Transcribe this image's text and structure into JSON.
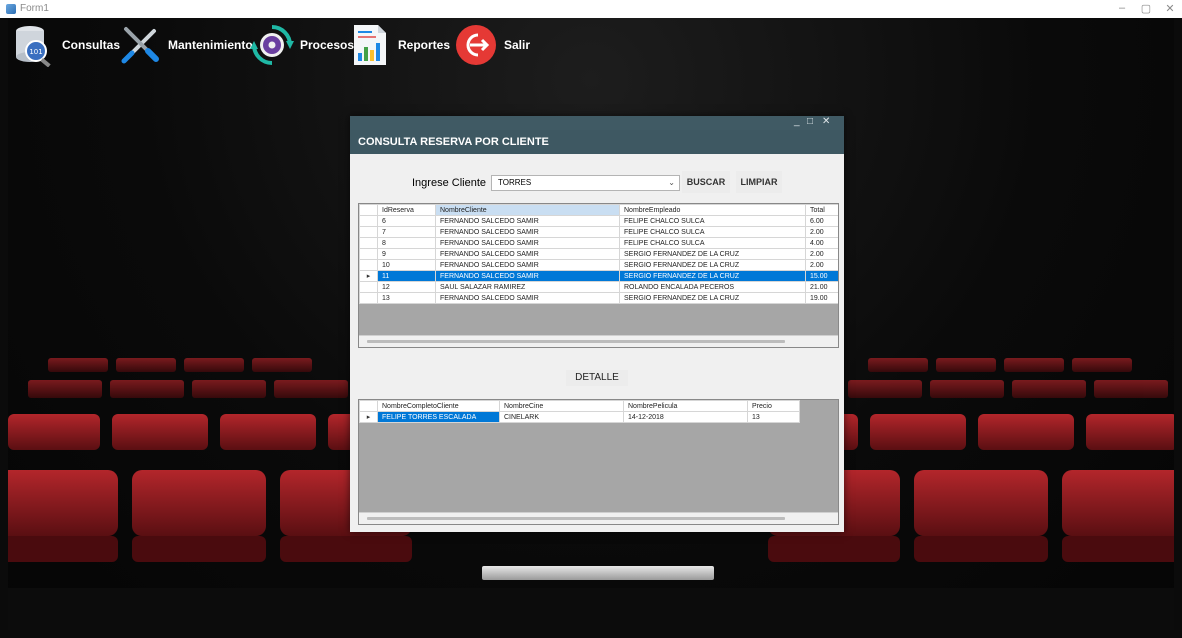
{
  "window": {
    "title": "Form1",
    "controls": [
      "–",
      "▢",
      "✕"
    ]
  },
  "menu": [
    {
      "label": "Consultas",
      "icon": "database-search-icon"
    },
    {
      "label": "Mantenimiento",
      "icon": "tools-icon"
    },
    {
      "label": "Procesos",
      "icon": "process-gear-icon"
    },
    {
      "label": "Reportes",
      "icon": "report-chart-icon"
    },
    {
      "label": "Salir",
      "icon": "exit-icon"
    }
  ],
  "form": {
    "caption": "CONSULTA RESERVA POR CLIENTE",
    "controls": [
      "_",
      "□",
      "✕"
    ],
    "cliente_label": "Ingrese Cliente",
    "cliente_value": "TORRES",
    "buscar_label": "BUSCAR",
    "limpiar_label": "LIMPIAR",
    "detalle_label": "DETALLE"
  },
  "reservas": {
    "columns": [
      "IdReserva",
      "NombreCliente",
      "NombreEmpleado",
      "Total"
    ],
    "selected_index": 5,
    "rows": [
      [
        "6",
        "FERNANDO SALCEDO SAMIR",
        "FELIPE CHALCO SULCA",
        "6.00"
      ],
      [
        "7",
        "FERNANDO SALCEDO SAMIR",
        "FELIPE CHALCO SULCA",
        "2.00"
      ],
      [
        "8",
        "FERNANDO SALCEDO SAMIR",
        "FELIPE CHALCO SULCA",
        "4.00"
      ],
      [
        "9",
        "FERNANDO SALCEDO SAMIR",
        "SERGIO FERNANDEZ DE LA CRUZ",
        "2.00"
      ],
      [
        "10",
        "FERNANDO SALCEDO SAMIR",
        "SERGIO FERNANDEZ DE LA CRUZ",
        "2.00"
      ],
      [
        "11",
        "FERNANDO SALCEDO SAMIR",
        "SERGIO FERNANDEZ DE LA CRUZ",
        "15.00"
      ],
      [
        "12",
        "SAUL SALAZAR RAMIREZ",
        "ROLANDO ENCALADA PECEROS",
        "21.00"
      ],
      [
        "13",
        "FERNANDO SALCEDO SAMIR",
        "SERGIO FERNANDEZ DE LA CRUZ",
        "19.00"
      ]
    ]
  },
  "detalle": {
    "columns": [
      "NombreCompletoCliente",
      "NombreCine",
      "NombrePelicula",
      "Precio"
    ],
    "rows": [
      [
        "FELIPE TORRES ESCALADA",
        "CINELARK",
        "14-12-2018",
        "13"
      ]
    ]
  },
  "colors": {
    "selection": "#0078d7",
    "form_header": "#3e5862",
    "exit_red": "#e53935",
    "process_teal": "#1fb8a5"
  }
}
